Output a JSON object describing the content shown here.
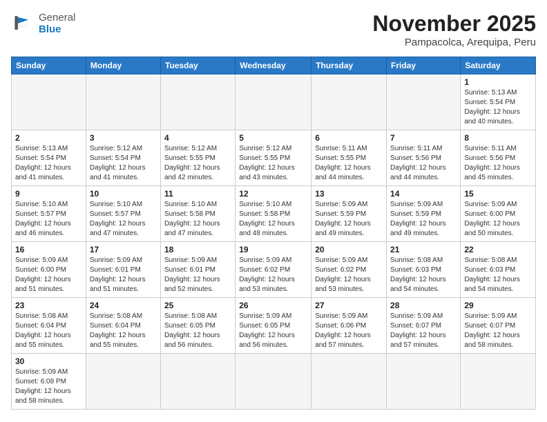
{
  "logo": {
    "general": "General",
    "blue": "Blue"
  },
  "title": "November 2025",
  "location": "Pampacolca, Arequipa, Peru",
  "weekdays": [
    "Sunday",
    "Monday",
    "Tuesday",
    "Wednesday",
    "Thursday",
    "Friday",
    "Saturday"
  ],
  "weeks": [
    [
      {
        "day": "",
        "info": ""
      },
      {
        "day": "",
        "info": ""
      },
      {
        "day": "",
        "info": ""
      },
      {
        "day": "",
        "info": ""
      },
      {
        "day": "",
        "info": ""
      },
      {
        "day": "",
        "info": ""
      },
      {
        "day": "1",
        "info": "Sunrise: 5:13 AM\nSunset: 5:54 PM\nDaylight: 12 hours and 40 minutes."
      }
    ],
    [
      {
        "day": "2",
        "info": "Sunrise: 5:13 AM\nSunset: 5:54 PM\nDaylight: 12 hours and 41 minutes."
      },
      {
        "day": "3",
        "info": "Sunrise: 5:12 AM\nSunset: 5:54 PM\nDaylight: 12 hours and 41 minutes."
      },
      {
        "day": "4",
        "info": "Sunrise: 5:12 AM\nSunset: 5:55 PM\nDaylight: 12 hours and 42 minutes."
      },
      {
        "day": "5",
        "info": "Sunrise: 5:12 AM\nSunset: 5:55 PM\nDaylight: 12 hours and 43 minutes."
      },
      {
        "day": "6",
        "info": "Sunrise: 5:11 AM\nSunset: 5:55 PM\nDaylight: 12 hours and 44 minutes."
      },
      {
        "day": "7",
        "info": "Sunrise: 5:11 AM\nSunset: 5:56 PM\nDaylight: 12 hours and 44 minutes."
      },
      {
        "day": "8",
        "info": "Sunrise: 5:11 AM\nSunset: 5:56 PM\nDaylight: 12 hours and 45 minutes."
      }
    ],
    [
      {
        "day": "9",
        "info": "Sunrise: 5:10 AM\nSunset: 5:57 PM\nDaylight: 12 hours and 46 minutes."
      },
      {
        "day": "10",
        "info": "Sunrise: 5:10 AM\nSunset: 5:57 PM\nDaylight: 12 hours and 47 minutes."
      },
      {
        "day": "11",
        "info": "Sunrise: 5:10 AM\nSunset: 5:58 PM\nDaylight: 12 hours and 47 minutes."
      },
      {
        "day": "12",
        "info": "Sunrise: 5:10 AM\nSunset: 5:58 PM\nDaylight: 12 hours and 48 minutes."
      },
      {
        "day": "13",
        "info": "Sunrise: 5:09 AM\nSunset: 5:59 PM\nDaylight: 12 hours and 49 minutes."
      },
      {
        "day": "14",
        "info": "Sunrise: 5:09 AM\nSunset: 5:59 PM\nDaylight: 12 hours and 49 minutes."
      },
      {
        "day": "15",
        "info": "Sunrise: 5:09 AM\nSunset: 6:00 PM\nDaylight: 12 hours and 50 minutes."
      }
    ],
    [
      {
        "day": "16",
        "info": "Sunrise: 5:09 AM\nSunset: 6:00 PM\nDaylight: 12 hours and 51 minutes."
      },
      {
        "day": "17",
        "info": "Sunrise: 5:09 AM\nSunset: 6:01 PM\nDaylight: 12 hours and 51 minutes."
      },
      {
        "day": "18",
        "info": "Sunrise: 5:09 AM\nSunset: 6:01 PM\nDaylight: 12 hours and 52 minutes."
      },
      {
        "day": "19",
        "info": "Sunrise: 5:09 AM\nSunset: 6:02 PM\nDaylight: 12 hours and 53 minutes."
      },
      {
        "day": "20",
        "info": "Sunrise: 5:09 AM\nSunset: 6:02 PM\nDaylight: 12 hours and 53 minutes."
      },
      {
        "day": "21",
        "info": "Sunrise: 5:08 AM\nSunset: 6:03 PM\nDaylight: 12 hours and 54 minutes."
      },
      {
        "day": "22",
        "info": "Sunrise: 5:08 AM\nSunset: 6:03 PM\nDaylight: 12 hours and 54 minutes."
      }
    ],
    [
      {
        "day": "23",
        "info": "Sunrise: 5:08 AM\nSunset: 6:04 PM\nDaylight: 12 hours and 55 minutes."
      },
      {
        "day": "24",
        "info": "Sunrise: 5:08 AM\nSunset: 6:04 PM\nDaylight: 12 hours and 55 minutes."
      },
      {
        "day": "25",
        "info": "Sunrise: 5:08 AM\nSunset: 6:05 PM\nDaylight: 12 hours and 56 minutes."
      },
      {
        "day": "26",
        "info": "Sunrise: 5:09 AM\nSunset: 6:05 PM\nDaylight: 12 hours and 56 minutes."
      },
      {
        "day": "27",
        "info": "Sunrise: 5:09 AM\nSunset: 6:06 PM\nDaylight: 12 hours and 57 minutes."
      },
      {
        "day": "28",
        "info": "Sunrise: 5:09 AM\nSunset: 6:07 PM\nDaylight: 12 hours and 57 minutes."
      },
      {
        "day": "29",
        "info": "Sunrise: 5:09 AM\nSunset: 6:07 PM\nDaylight: 12 hours and 58 minutes."
      }
    ],
    [
      {
        "day": "30",
        "info": "Sunrise: 5:09 AM\nSunset: 6:08 PM\nDaylight: 12 hours and 58 minutes."
      },
      {
        "day": "",
        "info": ""
      },
      {
        "day": "",
        "info": ""
      },
      {
        "day": "",
        "info": ""
      },
      {
        "day": "",
        "info": ""
      },
      {
        "day": "",
        "info": ""
      },
      {
        "day": "",
        "info": ""
      }
    ]
  ]
}
